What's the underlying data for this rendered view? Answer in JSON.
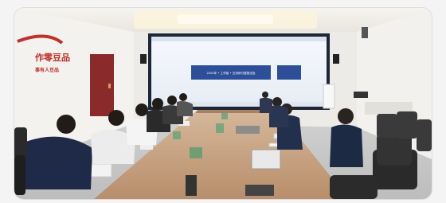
{
  "photo": {
    "wall_logo": {
      "line1": "作零豆品",
      "line2": "事有人豆品"
    },
    "screen": {
      "slide_text": "2024年 • 工作组 • 交流研讨暨推进会"
    },
    "colors": {
      "wall": "#ecebe8",
      "ceiling": "#f1efe9",
      "table": "#c9a98a",
      "screen_bg": "#eef3fb",
      "slide_banner": "#2d4f9a",
      "logo_red": "#c0312b",
      "door_red": "#8a2a2a"
    }
  }
}
